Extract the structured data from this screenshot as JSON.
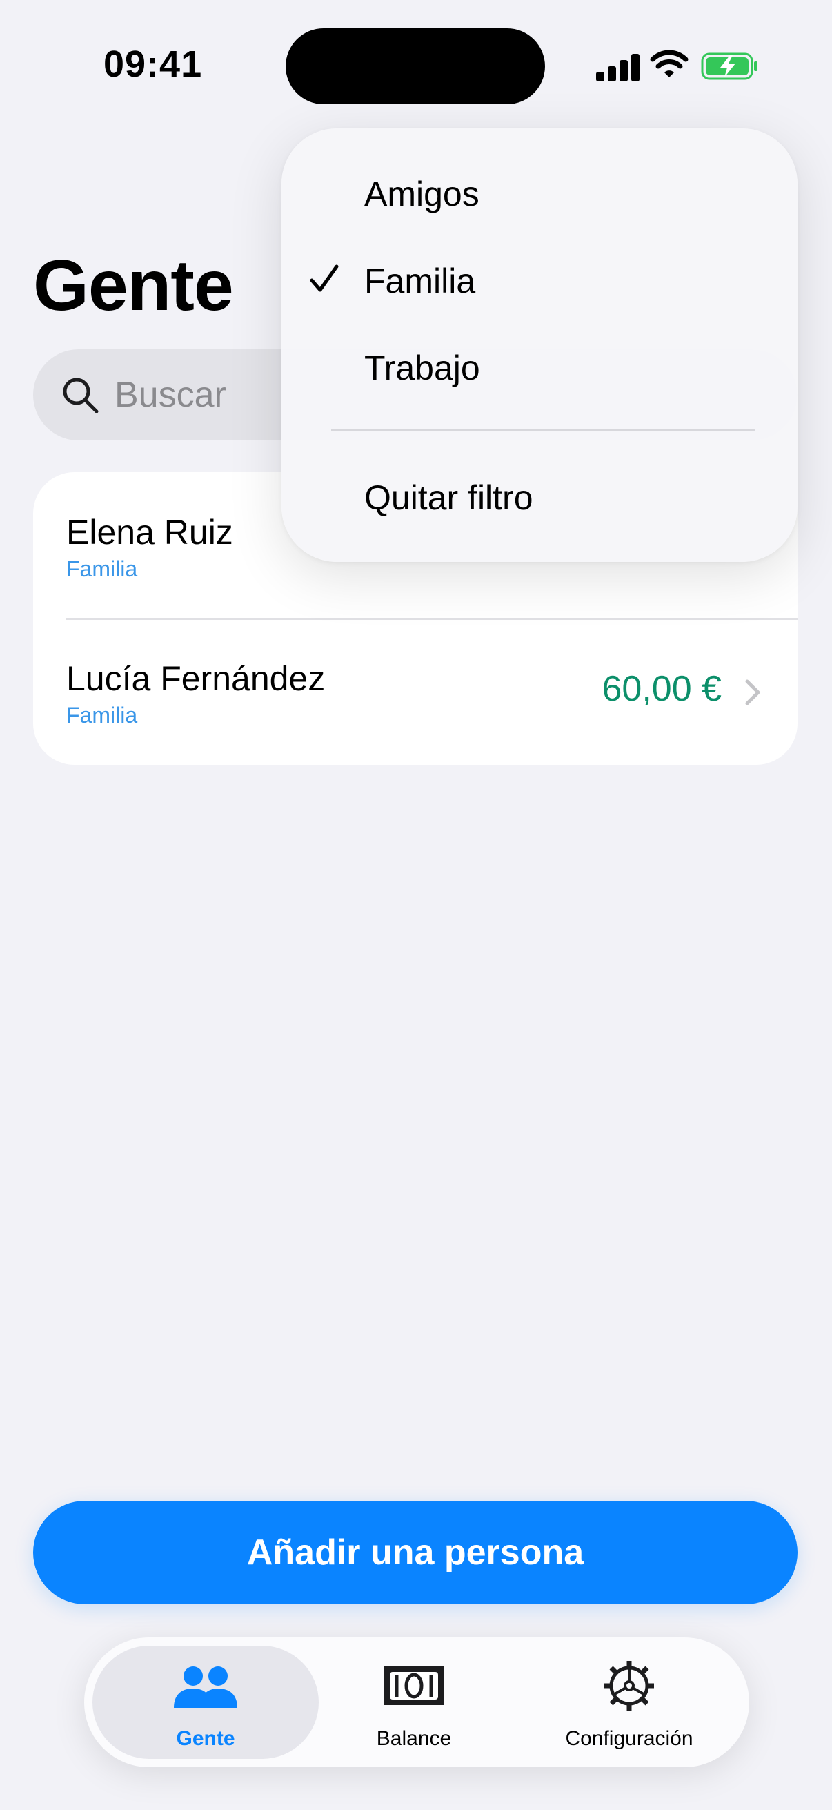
{
  "status_bar": {
    "time": "09:41"
  },
  "header": {
    "title": "Gente"
  },
  "search": {
    "placeholder": "Buscar"
  },
  "people": [
    {
      "name": "Elena Ruiz",
      "group": "Familia",
      "amount": ""
    },
    {
      "name": "Lucía Fernández",
      "group": "Familia",
      "amount": "60,00 €",
      "amount_color": "#0c8f6a"
    }
  ],
  "filter_menu": {
    "options": [
      {
        "label": "Amigos",
        "selected": false
      },
      {
        "label": "Familia",
        "selected": true
      },
      {
        "label": "Trabajo",
        "selected": false
      }
    ],
    "clear_label": "Quitar filtro"
  },
  "actions": {
    "add_person_label": "Añadir una persona"
  },
  "tabbar": {
    "tabs": [
      {
        "label": "Gente",
        "icon": "people-icon",
        "active": true
      },
      {
        "label": "Balance",
        "icon": "banknote-icon",
        "active": false
      },
      {
        "label": "Configuración",
        "icon": "gear-icon",
        "active": false
      }
    ]
  },
  "colors": {
    "accent": "#0a84ff",
    "positive": "#0c8f6a",
    "group_label": "#3a96e8",
    "background": "#f2f2f7"
  }
}
